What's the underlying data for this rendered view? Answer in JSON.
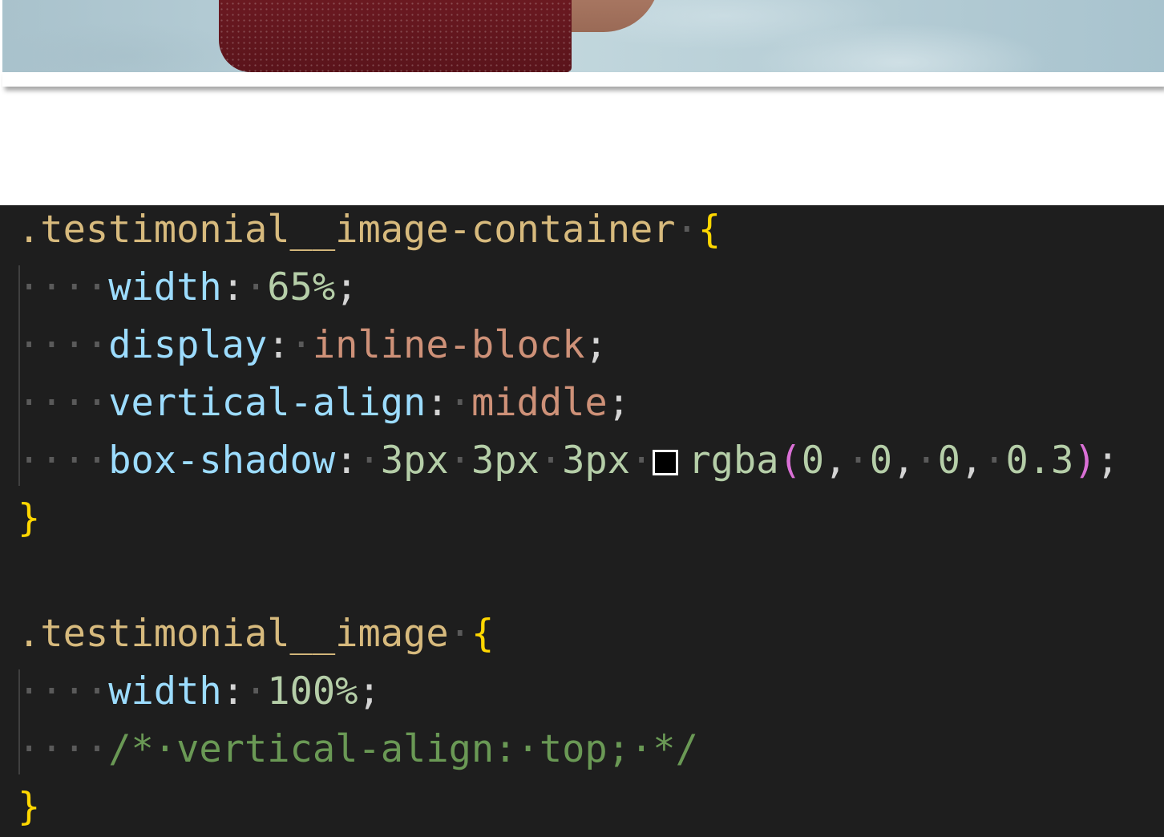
{
  "code": {
    "block1": {
      "selector": ".testimonial__image-container",
      "open_brace": "{",
      "close_brace": "}",
      "decls": [
        {
          "prop": "width",
          "value": "65%"
        },
        {
          "prop": "display",
          "value": "inline-block"
        },
        {
          "prop": "vertical-align",
          "value": "middle"
        },
        {
          "prop": "box-shadow",
          "lengths": [
            "3px",
            "3px",
            "3px"
          ],
          "fn": "rgba",
          "args": [
            "0",
            "0",
            "0",
            "0.3"
          ]
        }
      ]
    },
    "block2": {
      "selector": ".testimonial__image",
      "open_brace": "{",
      "close_brace": "}",
      "decls": [
        {
          "prop": "width",
          "value": "100%"
        }
      ],
      "comment": "/* vertical-align: top; */"
    }
  },
  "colors": {
    "editor_background": "#1e1e1e",
    "selector": "#d7ba7d",
    "brace": "#ffd700",
    "property": "#9cdcfe",
    "number": "#b5cea8",
    "keyword_value": "#ce9178",
    "function_paren": "#da70d6",
    "comment": "#6a9955",
    "color_swatch": "#000000"
  }
}
